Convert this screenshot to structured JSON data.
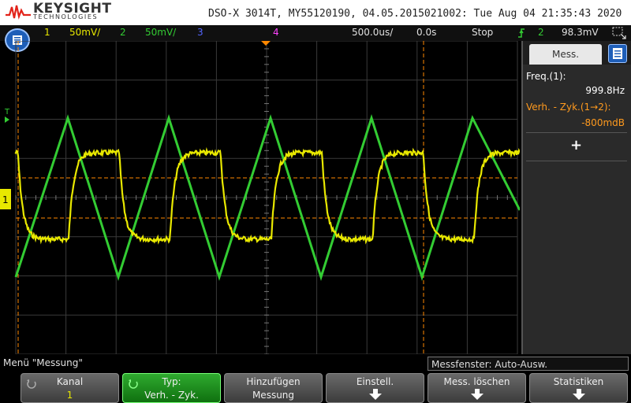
{
  "header": {
    "brand": "KEYSIGHT",
    "brand_sub": "TECHNOLOGIES",
    "info": "DSO-X 3014T, MY55120190, 04.05.2015021002: Tue Aug 04 21:35:43 2020"
  },
  "status": {
    "ch1_num": "1",
    "ch1_scale": "50mV/",
    "ch2_num": "2",
    "ch2_scale": "50mV/",
    "ch3_num": "3",
    "ch4_num": "4",
    "timebase": "500.0us/",
    "delay": "0.0s",
    "run_state": "Stop",
    "trigger_source": "2",
    "trigger_level": "98.3mV"
  },
  "screen": {
    "trigger_marker": "T",
    "ch1_marker": "1"
  },
  "side_panel": {
    "tab_label": "Mess.",
    "meas1_label": "Freq.(1):",
    "meas1_value": "999.8Hz",
    "meas2_label": "Verh. - Zyk.(1→2):",
    "meas2_value": "-800mdB",
    "add_label": "+"
  },
  "bottom": {
    "menu_title": "Menü \"Messung\"",
    "meas_window": "Messfenster: Auto-Ausw."
  },
  "softkeys": [
    {
      "line1": "Kanal",
      "line2": "1"
    },
    {
      "line1": "Typ:",
      "line2": "Verh. - Zyk."
    },
    {
      "line1": "Hinzufügen",
      "line2": "Messung"
    },
    {
      "line1": "Einstell.",
      "line2": ""
    },
    {
      "line1": "Mess. löschen",
      "line2": ""
    },
    {
      "line1": "Statistiken",
      "line2": ""
    }
  ],
  "colors": {
    "ch1": "#e8e800",
    "ch2": "#33cc33",
    "ch3": "#5566ff",
    "ch4": "#ff44ff",
    "cursor": "#ff8800",
    "menu_blue": "#1e5eb8"
  },
  "chart_data": {
    "type": "line",
    "timebase_per_div": "500.0us",
    "volts_per_div": {
      "ch1": "50mV",
      "ch2": "50mV"
    },
    "divisions": {
      "x": 10,
      "y": 8
    },
    "series": [
      {
        "name": "1",
        "shape": "square",
        "frequency_hz": 999.8
      },
      {
        "name": "2",
        "shape": "triangle"
      }
    ]
  }
}
